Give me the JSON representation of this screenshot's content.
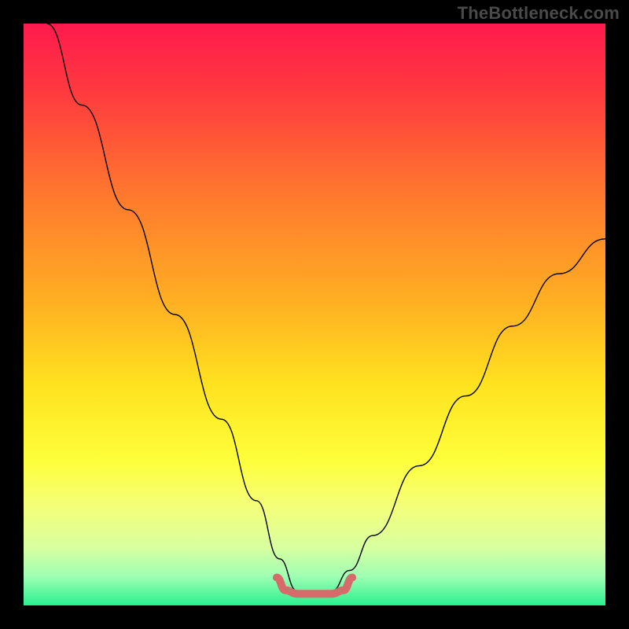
{
  "watermark": "TheBottleneck.com",
  "chart_data": {
    "type": "line",
    "title": "",
    "xlabel": "",
    "ylabel": "",
    "xlim": [
      0,
      100
    ],
    "ylim": [
      0,
      100
    ],
    "grid": false,
    "legend": false,
    "background_gradient": {
      "stops": [
        {
          "offset": 0.0,
          "color": "#ff1a4d"
        },
        {
          "offset": 0.12,
          "color": "#ff3b3e"
        },
        {
          "offset": 0.3,
          "color": "#ff7a2d"
        },
        {
          "offset": 0.48,
          "color": "#ffb022"
        },
        {
          "offset": 0.62,
          "color": "#ffe21f"
        },
        {
          "offset": 0.75,
          "color": "#fdff3a"
        },
        {
          "offset": 0.83,
          "color": "#f4ff7a"
        },
        {
          "offset": 0.9,
          "color": "#d8ffa0"
        },
        {
          "offset": 0.95,
          "color": "#9fffb4"
        },
        {
          "offset": 1.0,
          "color": "#29f08f"
        }
      ]
    },
    "series": [
      {
        "name": "bottleneck-curve",
        "color": "#000000",
        "stroke_width": 1.4,
        "x": [
          4,
          10,
          18,
          26,
          34,
          40,
          44,
          47,
          50,
          53,
          56,
          60,
          68,
          76,
          84,
          92,
          100
        ],
        "y": [
          100,
          86,
          68,
          50,
          32,
          18,
          8,
          2.5,
          2,
          2.5,
          6,
          12,
          24,
          36,
          48,
          57,
          63
        ]
      },
      {
        "name": "marker-band",
        "color": "#d76a6a",
        "stroke_width": 10,
        "linecap": "round",
        "x": [
          43.5,
          45,
          47,
          49,
          51,
          53,
          55,
          56.5
        ],
        "y": [
          4.8,
          2.6,
          2.0,
          2.0,
          2.0,
          2.0,
          2.6,
          4.8
        ]
      }
    ]
  }
}
